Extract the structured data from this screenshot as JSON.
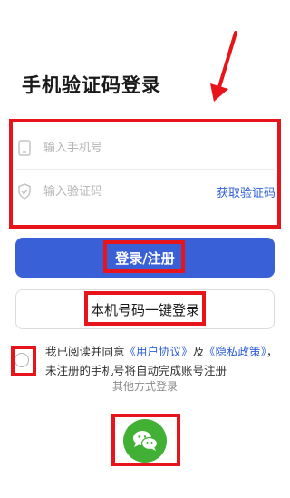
{
  "page": {
    "title": "手机验证码登录"
  },
  "form": {
    "phone_placeholder": "输入手机号",
    "code_placeholder": "输入验证码",
    "get_code_label": "获取验证码"
  },
  "buttons": {
    "login_label": "登录/注册",
    "one_key_label": "本机号码一键登录"
  },
  "agreement": {
    "prefix": "我已阅读并同意",
    "user_agreement": "《用户协议》",
    "and": "及",
    "privacy_policy": "《隐私政策》",
    "suffix": "，未注册的手机号将自动完成账号注册"
  },
  "other_login": {
    "label": "其他方式登录",
    "icons": [
      "wechat-icon"
    ]
  },
  "colors": {
    "accent": "#3a60d8",
    "link": "#2f5fd8",
    "wechat": "#41b035",
    "annotation": "#e8141c"
  },
  "icons": [
    "phone-icon",
    "shield-icon",
    "wechat-icon",
    "arrow-annotation"
  ]
}
